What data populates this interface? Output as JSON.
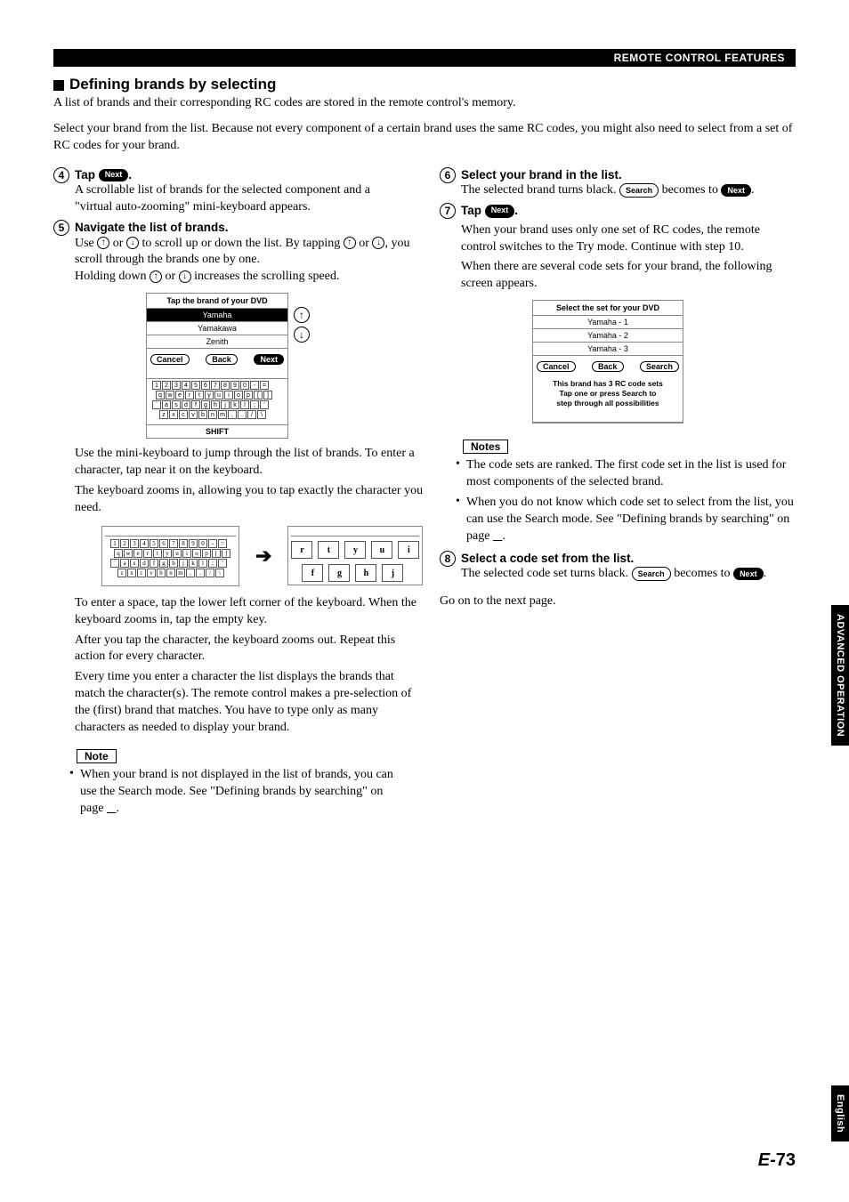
{
  "header": {
    "section": "REMOTE CONTROL FEATURES"
  },
  "title": "Defining brands by selecting",
  "intro1": "A list of brands and their corresponding RC codes are stored in the remote control's memory.",
  "intro2": "Select your brand from the list. Because not every component of a certain brand uses the same RC codes, you might also need to select from a set of RC codes for your brand.",
  "labels": {
    "next": "Next",
    "search": "Search",
    "back": "Back",
    "cancel": "Cancel",
    "shift": "SHIFT"
  },
  "step4": {
    "num": "4",
    "head_a": "Tap ",
    "head_b": ".",
    "body": "A scrollable list of brands for the selected component and a \"virtual auto-zooming\" mini-keyboard appears."
  },
  "step5": {
    "num": "5",
    "head": "Navigate the list of brands.",
    "l1a": "Use ",
    "l1b": " or ",
    "l1c": " to scroll up or down the list. By tapping ",
    "l1d": " or ",
    "l1e": ", you scroll through the brands one by one.",
    "l2a": "Holding down ",
    "l2b": " or ",
    "l2c": " increases the scrolling speed.",
    "screen": {
      "title": "Tap the brand of your DVD",
      "items": [
        "Yamaha",
        "Yamakawa",
        "Zenith"
      ]
    },
    "p1": "Use the mini-keyboard to jump through the list of brands. To enter a character, tap near it on the keyboard.",
    "p2": "The keyboard zooms in, allowing you to tap exactly the character you need.",
    "p3": "To enter a space, tap the lower left corner of the keyboard. When the keyboard zooms in, tap the empty key.",
    "p4": "After you tap the character, the keyboard zooms out. Repeat this action for every character.",
    "p5": "Every time you enter a character the list displays the brands that match the character(s). The remote control makes a pre-selection of the (first) brand that matches. You have to type only as many characters as needed to display your brand.",
    "kb_rows": [
      [
        "1",
        "2",
        "3",
        "4",
        "5",
        "6",
        "7",
        "8",
        "9",
        "0",
        "-",
        "="
      ],
      [
        "q",
        "w",
        "e",
        "r",
        "t",
        "y",
        "u",
        "i",
        "o",
        "p",
        "[",
        "]"
      ],
      [
        "a",
        "s",
        "d",
        "f",
        "g",
        "h",
        "j",
        "k",
        "l",
        ";",
        "'"
      ],
      [
        "z",
        "x",
        "c",
        "v",
        "b",
        "n",
        "m",
        ",",
        ".",
        "/",
        "\\"
      ]
    ],
    "zoom_rows": [
      [
        "r",
        "t",
        "y",
        "u",
        "i"
      ],
      [
        "f",
        "g",
        "h",
        "j"
      ]
    ]
  },
  "note_l": {
    "label": "Note",
    "b1a": "When your brand is not displayed in the list of brands, you can use the Search mode. See \"Defining brands by searching\" on page",
    "b1b": "."
  },
  "step6": {
    "num": "6",
    "head": "Select your brand in the list.",
    "l1a": "The selected brand turns black. ",
    "l1b": " becomes to ",
    "l1c": "."
  },
  "step7": {
    "num": "7",
    "head_a": "Tap ",
    "head_b": ".",
    "p1": "When your brand uses only one set of RC codes, the remote control switches to the Try mode. Continue with step 10.",
    "p2": "When there are several code sets for your brand, the following screen appears.",
    "screen": {
      "title": "Select the set for your DVD",
      "items": [
        "Yamaha - 1",
        "Yamaha - 2",
        "Yamaha - 3"
      ],
      "msg1": "This brand has 3 RC code sets",
      "msg2": "Tap one or press Search to",
      "msg3": "step through all possibilities"
    }
  },
  "notes_r": {
    "label": "Notes",
    "b1": "The code sets are ranked. The first code set in the list is used for most components of the selected brand.",
    "b2a": "When you do not know which code set to select from the list, you can use the Search mode. See \"Defining brands by searching\" on page",
    "b2b": "."
  },
  "step8": {
    "num": "8",
    "head": "Select a code set from the list.",
    "l1a": "The selected code set turns black. ",
    "l1b": " becomes to ",
    "l1c": "."
  },
  "goon": "Go on to the next page.",
  "tabs": {
    "adv": "ADVANCED OPERATION",
    "eng": "English"
  },
  "pagenum": {
    "e": "E-",
    "n": "73"
  }
}
